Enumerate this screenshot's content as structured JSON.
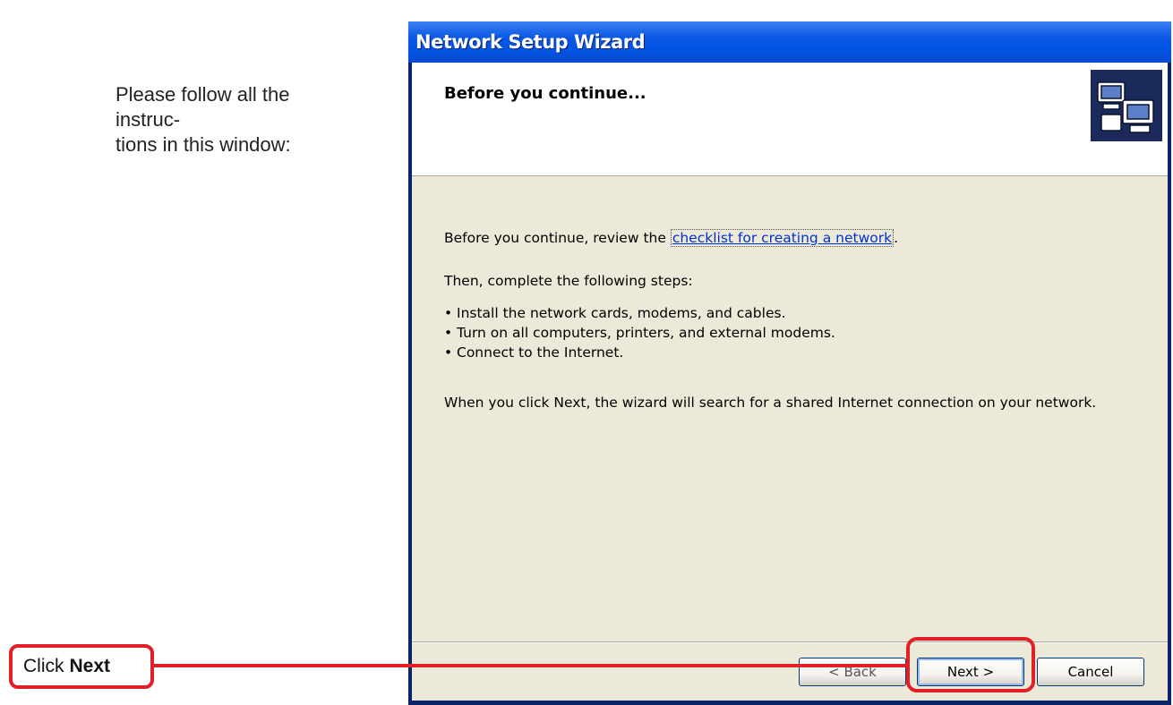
{
  "instruction": {
    "line1": "Please follow all the instruc-",
    "line2": "tions in this window:"
  },
  "callout": {
    "prefix": "Click",
    "emphasis": "Next"
  },
  "window": {
    "title": "Network Setup Wizard",
    "heading": "Before you continue...",
    "icon": "network-computers-icon"
  },
  "content": {
    "intro_text": "Before you continue, review the",
    "link_text": "checklist for creating a network",
    "intro_suffix": ".",
    "steps_intro": "Then, complete the following steps:",
    "steps": [
      "Install the network cards, modems, and cables.",
      "Turn on all computers, printers, and external modems.",
      "Connect to the Internet."
    ],
    "note": "When you click Next, the wizard will search for a shared Internet connection on your network."
  },
  "buttons": {
    "back": "< Back",
    "next": "Next >",
    "cancel": "Cancel"
  },
  "colors": {
    "titlebar": "#0054e3",
    "dialog_bg": "#ece9d8",
    "callout_border": "#e21f26",
    "link": "#0033cc"
  }
}
